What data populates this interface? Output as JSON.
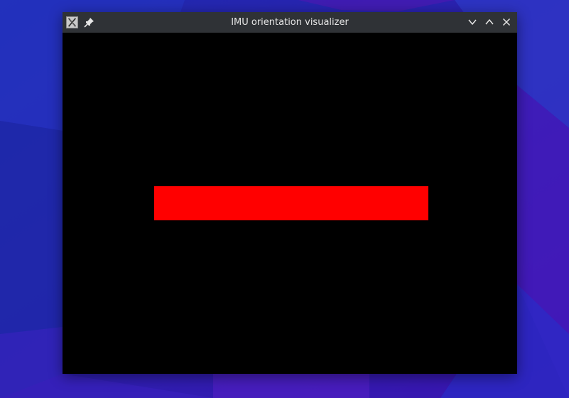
{
  "window": {
    "title": "IMU orientation visualizer",
    "app_icon": "x-window-icon",
    "pin_icon": "pin-icon",
    "controls": [
      "minimize-icon",
      "maximize-icon",
      "close-icon"
    ]
  },
  "colors": {
    "titlebar": "#2f3236",
    "canvas": "#000000",
    "indicator": "#ff0000",
    "desktop": "#2a14b8"
  }
}
